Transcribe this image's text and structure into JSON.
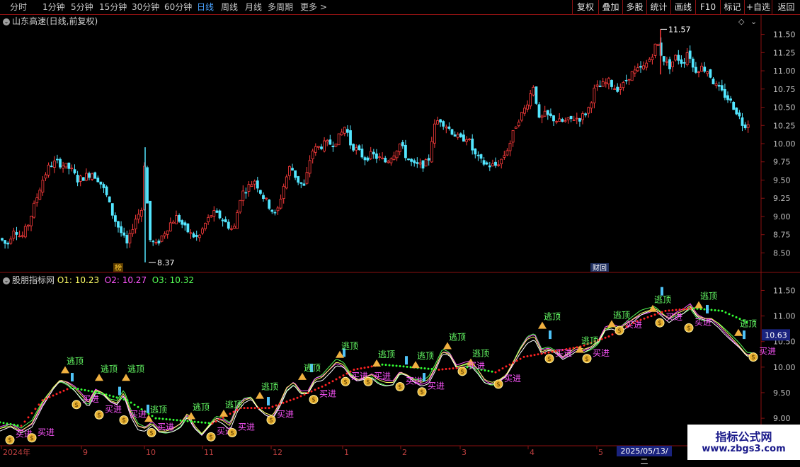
{
  "toolbar": {
    "periods": [
      "分时",
      "1分钟",
      "5分钟",
      "15分钟",
      "30分钟",
      "60分钟",
      "日线",
      "周线",
      "月线",
      "多周期",
      "更多 >"
    ],
    "active_period": "日线",
    "right_buttons": [
      "复权",
      "叠加",
      "多股",
      "统计",
      "画线",
      "F10",
      "标记",
      "+自选",
      "返回"
    ]
  },
  "stock": {
    "title": "山东高速(日线,前复权)"
  },
  "indicator": {
    "name": "股朋指标网",
    "o1_label": "O1: 10.23",
    "o2_label": "O2: 10.27",
    "o3_label": "O3: 10.32",
    "current_value": "10.63"
  },
  "markers": {
    "bang": "榜",
    "caibao": "财回"
  },
  "watermark": {
    "line1": "指标公式网",
    "line2": "www.zbgs3.com"
  },
  "date_box": "2025/05/13/二",
  "colors": {
    "up": "#ff3c3c",
    "down": "#53e6ff",
    "bg": "#000000",
    "grid": "#8a1111",
    "axis_text": "#c0c0c0",
    "o1": "#ffff66",
    "o2": "#ff55ff",
    "o3": "#55ff55",
    "red_dots": "#ff2222",
    "green_dots": "#33ff33"
  },
  "chart_data": [
    {
      "type": "candlestick",
      "title": "山东高速(日线,前复权)",
      "y_ticks": [
        8.5,
        8.75,
        9.0,
        9.25,
        9.5,
        9.75,
        10.0,
        10.25,
        10.5,
        10.75,
        11.0,
        11.25,
        11.5
      ],
      "ylim": [
        8.3,
        11.7
      ],
      "annotations": [
        {
          "label": "8.37",
          "value": 8.37
        },
        {
          "label": "11.57",
          "value": 11.57
        }
      ],
      "price_path": [
        [
          0,
          8.7
        ],
        [
          10,
          8.6
        ],
        [
          20,
          8.85
        ],
        [
          30,
          8.7
        ],
        [
          40,
          8.9
        ],
        [
          50,
          9.2
        ],
        [
          60,
          9.5
        ],
        [
          70,
          9.7
        ],
        [
          80,
          9.75
        ],
        [
          90,
          9.7
        ],
        [
          100,
          9.65
        ],
        [
          110,
          9.5
        ],
        [
          120,
          9.55
        ],
        [
          130,
          9.6
        ],
        [
          140,
          9.5
        ],
        [
          150,
          9.3
        ],
        [
          160,
          9.0
        ],
        [
          170,
          8.8
        ],
        [
          180,
          8.6
        ],
        [
          190,
          8.95
        ],
        [
          200,
          9.1
        ],
        [
          205,
          9.9
        ],
        [
          210,
          8.7
        ],
        [
          220,
          8.6
        ],
        [
          230,
          8.75
        ],
        [
          240,
          8.9
        ],
        [
          250,
          9.0
        ],
        [
          260,
          8.85
        ],
        [
          270,
          8.75
        ],
        [
          280,
          8.7
        ],
        [
          290,
          8.9
        ],
        [
          300,
          9.05
        ],
        [
          310,
          9.0
        ],
        [
          320,
          8.9
        ],
        [
          330,
          8.8
        ],
        [
          340,
          9.3
        ],
        [
          350,
          9.4
        ],
        [
          360,
          9.5
        ],
        [
          370,
          9.3
        ],
        [
          380,
          9.15
        ],
        [
          390,
          9.0
        ],
        [
          400,
          9.4
        ],
        [
          410,
          9.7
        ],
        [
          420,
          9.5
        ],
        [
          430,
          9.4
        ],
        [
          440,
          9.9
        ],
        [
          450,
          9.95
        ],
        [
          460,
          10.0
        ],
        [
          470,
          10.0
        ],
        [
          480,
          10.1
        ],
        [
          488,
          10.25
        ],
        [
          495,
          10.0
        ],
        [
          505,
          9.9
        ],
        [
          515,
          9.8
        ],
        [
          525,
          9.85
        ],
        [
          535,
          9.8
        ],
        [
          545,
          9.75
        ],
        [
          555,
          9.85
        ],
        [
          565,
          10.0
        ],
        [
          575,
          9.8
        ],
        [
          585,
          9.7
        ],
        [
          595,
          9.7
        ],
        [
          605,
          9.75
        ],
        [
          612,
          10.2
        ],
        [
          620,
          10.35
        ],
        [
          630,
          10.25
        ],
        [
          640,
          10.15
        ],
        [
          650,
          10.05
        ],
        [
          660,
          10.1
        ],
        [
          670,
          9.85
        ],
        [
          680,
          9.75
        ],
        [
          690,
          9.7
        ],
        [
          700,
          9.7
        ],
        [
          710,
          9.8
        ],
        [
          720,
          10.0
        ],
        [
          730,
          10.3
        ],
        [
          740,
          10.45
        ],
        [
          750,
          10.7
        ],
        [
          755,
          10.85
        ],
        [
          760,
          10.3
        ],
        [
          770,
          10.4
        ],
        [
          780,
          10.35
        ],
        [
          790,
          10.3
        ],
        [
          800,
          10.3
        ],
        [
          810,
          10.35
        ],
        [
          820,
          10.35
        ],
        [
          830,
          10.45
        ],
        [
          840,
          10.75
        ],
        [
          850,
          10.8
        ],
        [
          860,
          10.85
        ],
        [
          870,
          10.75
        ],
        [
          880,
          10.8
        ],
        [
          890,
          10.95
        ],
        [
          900,
          11.0
        ],
        [
          910,
          11.05
        ],
        [
          920,
          11.2
        ],
        [
          928,
          11.4
        ],
        [
          935,
          11.2
        ],
        [
          945,
          11.05
        ],
        [
          955,
          11.2
        ],
        [
          965,
          11.1
        ],
        [
          972,
          11.3
        ],
        [
          980,
          11.0
        ],
        [
          990,
          11.05
        ],
        [
          1000,
          11.0
        ],
        [
          1010,
          10.8
        ],
        [
          1020,
          10.7
        ],
        [
          1030,
          10.6
        ],
        [
          1040,
          10.45
        ],
        [
          1050,
          10.25
        ],
        [
          1058,
          10.3
        ]
      ]
    },
    {
      "type": "line",
      "title": "股朋指标网",
      "y_ticks": [
        9.0,
        9.5,
        10.0,
        10.5,
        11.0,
        11.5
      ],
      "ylim": [
        8.6,
        11.7
      ],
      "x_labels": [
        "2024年",
        "9",
        "10",
        "11",
        "12",
        "1",
        "2",
        "3",
        "4",
        "5"
      ],
      "series": [
        {
          "name": "O1",
          "last": 10.23
        },
        {
          "name": "O2",
          "last": 10.27
        },
        {
          "name": "O3",
          "last": 10.32
        }
      ],
      "signal_labels": {
        "top": "逃顶",
        "buy": "买进"
      },
      "o1_path": [
        [
          0,
          8.8
        ],
        [
          15,
          8.85
        ],
        [
          30,
          8.75
        ],
        [
          45,
          8.9
        ],
        [
          60,
          9.3
        ],
        [
          75,
          9.6
        ],
        [
          85,
          9.75
        ],
        [
          95,
          9.7
        ],
        [
          105,
          9.6
        ],
        [
          115,
          9.45
        ],
        [
          125,
          9.3
        ],
        [
          135,
          9.55
        ],
        [
          145,
          9.5
        ],
        [
          155,
          9.35
        ],
        [
          165,
          9.3
        ],
        [
          175,
          9.5
        ],
        [
          185,
          9.1
        ],
        [
          195,
          8.85
        ],
        [
          205,
          8.8
        ],
        [
          215,
          8.9
        ],
        [
          225,
          8.75
        ],
        [
          235,
          8.75
        ],
        [
          245,
          8.8
        ],
        [
          255,
          8.9
        ],
        [
          265,
          9.1
        ],
        [
          275,
          8.85
        ],
        [
          285,
          8.7
        ],
        [
          295,
          8.85
        ],
        [
          305,
          9.0
        ],
        [
          315,
          8.95
        ],
        [
          325,
          8.85
        ],
        [
          335,
          9.2
        ],
        [
          345,
          9.35
        ],
        [
          355,
          9.4
        ],
        [
          365,
          9.2
        ],
        [
          375,
          9.1
        ],
        [
          385,
          9.05
        ],
        [
          395,
          9.3
        ],
        [
          405,
          9.6
        ],
        [
          415,
          9.7
        ],
        [
          425,
          9.5
        ],
        [
          435,
          9.5
        ],
        [
          445,
          9.75
        ],
        [
          455,
          9.8
        ],
        [
          465,
          9.95
        ],
        [
          475,
          10.1
        ],
        [
          485,
          10.05
        ],
        [
          495,
          9.85
        ],
        [
          505,
          9.75
        ],
        [
          515,
          9.8
        ],
        [
          525,
          9.85
        ],
        [
          535,
          9.75
        ],
        [
          545,
          9.7
        ],
        [
          555,
          9.7
        ],
        [
          565,
          9.9
        ],
        [
          575,
          9.85
        ],
        [
          585,
          9.75
        ],
        [
          595,
          9.7
        ],
        [
          605,
          9.75
        ],
        [
          615,
          10.0
        ],
        [
          625,
          10.3
        ],
        [
          635,
          10.25
        ],
        [
          645,
          10.0
        ],
        [
          655,
          10.05
        ],
        [
          665,
          10.1
        ],
        [
          675,
          9.95
        ],
        [
          685,
          9.75
        ],
        [
          695,
          9.7
        ],
        [
          705,
          9.75
        ],
        [
          715,
          9.85
        ],
        [
          725,
          10.1
        ],
        [
          735,
          10.35
        ],
        [
          745,
          10.55
        ],
        [
          755,
          10.6
        ],
        [
          765,
          10.3
        ],
        [
          775,
          10.35
        ],
        [
          785,
          10.3
        ],
        [
          795,
          10.2
        ],
        [
          805,
          10.3
        ],
        [
          815,
          10.4
        ],
        [
          825,
          10.35
        ],
        [
          835,
          10.4
        ],
        [
          845,
          10.5
        ],
        [
          855,
          10.75
        ],
        [
          865,
          10.8
        ],
        [
          875,
          10.75
        ],
        [
          885,
          10.85
        ],
        [
          895,
          10.95
        ],
        [
          905,
          11.05
        ],
        [
          915,
          11.1
        ],
        [
          925,
          11.15
        ],
        [
          935,
          11.05
        ],
        [
          945,
          10.95
        ],
        [
          955,
          11.05
        ],
        [
          965,
          11.1
        ],
        [
          975,
          11.2
        ],
        [
          985,
          11.0
        ],
        [
          995,
          10.95
        ],
        [
          1005,
          10.95
        ],
        [
          1015,
          10.85
        ],
        [
          1025,
          10.7
        ],
        [
          1035,
          10.55
        ],
        [
          1045,
          10.4
        ],
        [
          1055,
          10.23
        ]
      ],
      "dots_path": [
        [
          0,
          8.92
        ],
        [
          30,
          8.85
        ],
        [
          60,
          9.35
        ],
        [
          100,
          9.6
        ],
        [
          140,
          9.5
        ],
        [
          180,
          9.35
        ],
        [
          220,
          9.0
        ],
        [
          260,
          8.95
        ],
        [
          300,
          8.9
        ],
        [
          340,
          9.2
        ],
        [
          380,
          9.2
        ],
        [
          420,
          9.4
        ],
        [
          460,
          9.65
        ],
        [
          500,
          9.95
        ],
        [
          540,
          10.05
        ],
        [
          580,
          10.0
        ],
        [
          620,
          9.95
        ],
        [
          660,
          10.0
        ],
        [
          700,
          9.9
        ],
        [
          740,
          10.2
        ],
        [
          780,
          10.3
        ],
        [
          820,
          10.4
        ],
        [
          860,
          10.6
        ],
        [
          900,
          10.9
        ],
        [
          940,
          11.1
        ],
        [
          980,
          11.15
        ],
        [
          1020,
          11.1
        ],
        [
          1060,
          10.85
        ]
      ],
      "tops": [
        [
          92,
          9.95
        ],
        [
          140,
          9.8
        ],
        [
          178,
          9.8
        ],
        [
          210,
          9.0
        ],
        [
          270,
          9.05
        ],
        [
          316,
          9.1
        ],
        [
          367,
          9.45
        ],
        [
          427,
          9.82
        ],
        [
          480,
          10.25
        ],
        [
          532,
          10.08
        ],
        [
          587,
          10.05
        ],
        [
          632,
          10.42
        ],
        [
          665,
          10.1
        ],
        [
          766,
          10.82
        ],
        [
          819,
          10.35
        ],
        [
          864,
          10.85
        ],
        [
          922,
          11.15
        ],
        [
          987,
          11.22
        ],
        [
          1043,
          10.68
        ]
      ],
      "buys": [
        [
          14,
          8.66
        ],
        [
          45,
          8.7
        ],
        [
          108,
          9.35
        ],
        [
          140,
          9.15
        ],
        [
          175,
          9.05
        ],
        [
          214,
          8.8
        ],
        [
          298,
          8.72
        ],
        [
          328,
          8.8
        ],
        [
          383,
          9.05
        ],
        [
          443,
          9.45
        ],
        [
          488,
          9.8
        ],
        [
          520,
          9.8
        ],
        [
          565,
          9.7
        ],
        [
          596,
          9.6
        ],
        [
          653,
          10.0
        ],
        [
          704,
          9.75
        ],
        [
          776,
          10.25
        ],
        [
          829,
          10.25
        ],
        [
          875,
          10.8
        ],
        [
          932,
          10.95
        ],
        [
          973,
          10.85
        ],
        [
          1064,
          10.28
        ]
      ]
    }
  ]
}
